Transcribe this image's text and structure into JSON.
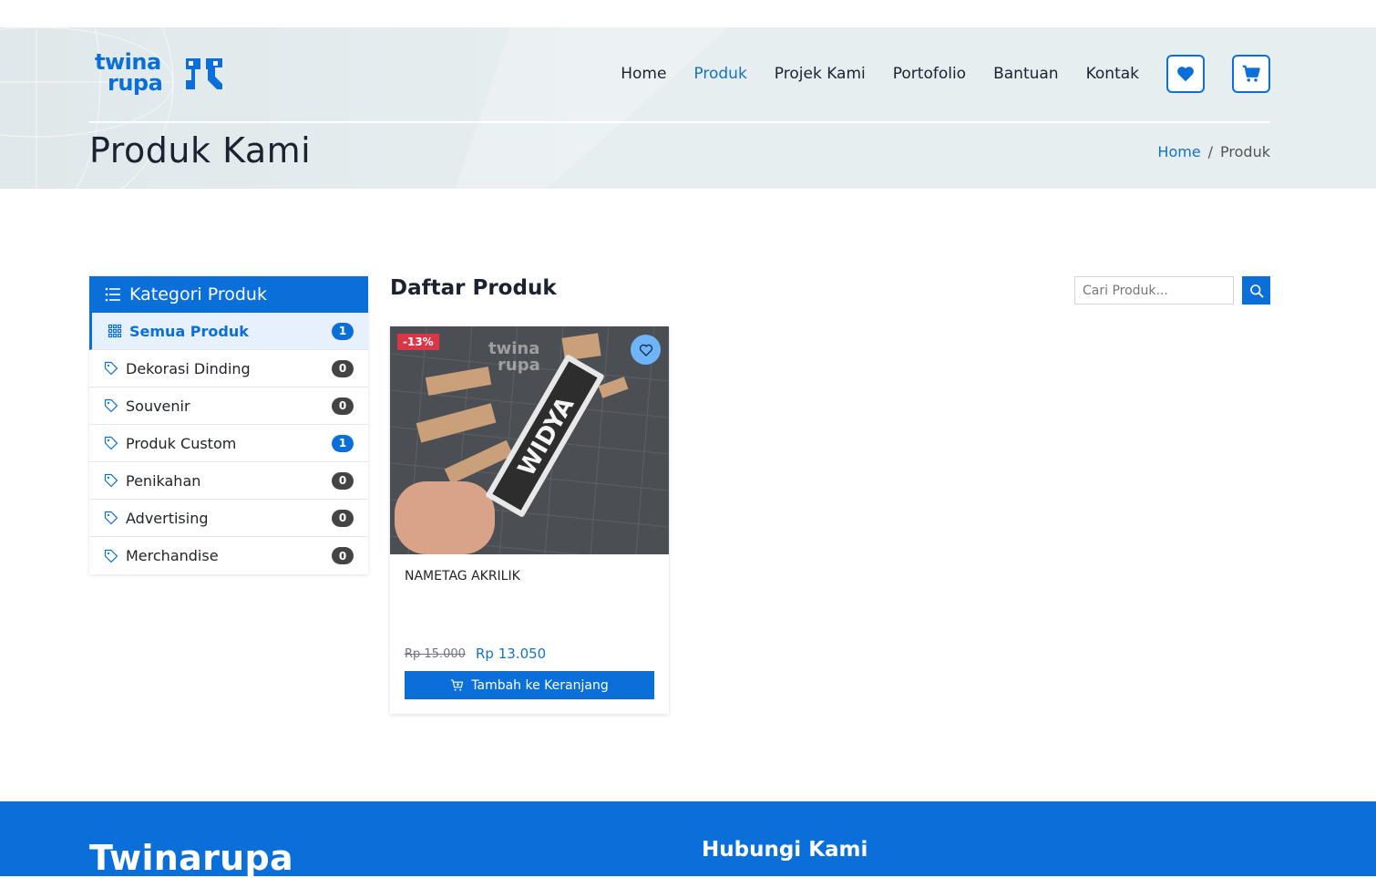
{
  "brand": {
    "logo_line1": "twina",
    "logo_line2": "rupa",
    "primary_color": "#0a6fd8"
  },
  "nav": {
    "items": [
      {
        "label": "Home",
        "active": false
      },
      {
        "label": "Produk",
        "active": true
      },
      {
        "label": "Projek Kami",
        "active": false
      },
      {
        "label": "Portofolio",
        "active": false
      },
      {
        "label": "Bantuan",
        "active": false
      },
      {
        "label": "Kontak",
        "active": false
      }
    ],
    "wishlist_icon": "heart-icon",
    "cart_icon": "cart-icon"
  },
  "hero": {
    "title": "Produk Kami",
    "breadcrumb": {
      "home": "Home",
      "separator": "/",
      "current": "Produk"
    }
  },
  "sidebar": {
    "title": "Kategori Produk",
    "items": [
      {
        "label": "Semua Produk",
        "count": "1",
        "active": true,
        "icon": "grid-icon"
      },
      {
        "label": "Dekorasi Dinding",
        "count": "0",
        "active": false,
        "icon": "tag-icon"
      },
      {
        "label": "Souvenir",
        "count": "0",
        "active": false,
        "icon": "tag-icon"
      },
      {
        "label": "Produk Custom",
        "count": "1",
        "active": false,
        "icon": "tag-icon"
      },
      {
        "label": "Penikahan",
        "count": "0",
        "active": false,
        "icon": "tag-icon"
      },
      {
        "label": "Advertising",
        "count": "0",
        "active": false,
        "icon": "tag-icon"
      },
      {
        "label": "Merchandise",
        "count": "0",
        "active": false,
        "icon": "tag-icon"
      }
    ]
  },
  "products": {
    "title": "Daftar Produk",
    "search_placeholder": "Cari Produk...",
    "items": [
      {
        "name": "NAMETAG AKRILIK",
        "discount": "-13%",
        "old_price": "Rp 15.000",
        "price": "Rp 13.050",
        "cart_label": "Tambah ke Keranjang",
        "image_text": "WIDYA",
        "watermark_line1": "twina",
        "watermark_line2": "rupa"
      }
    ]
  },
  "footer": {
    "brand": "Twinarupa",
    "contact_title": "Hubungi Kami"
  }
}
